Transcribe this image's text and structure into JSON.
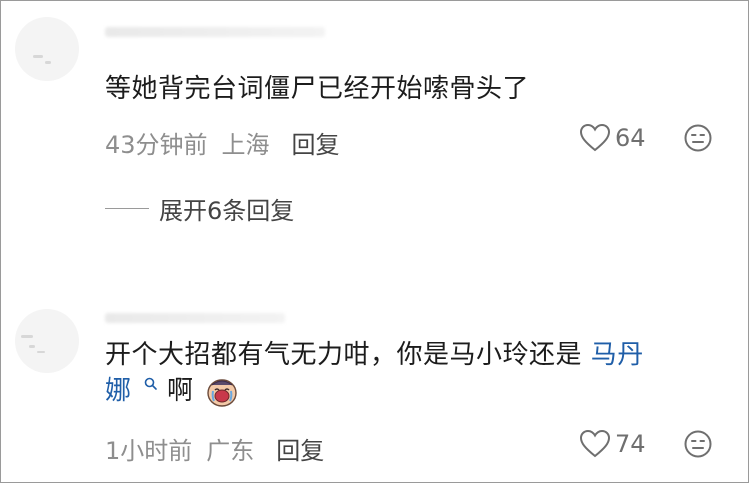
{
  "comments": [
    {
      "text": "等她背完台词僵尸已经开始嗦骨头了",
      "time": "43分钟前",
      "location": "上海",
      "reply_label": "回复",
      "likes": "64",
      "expand_label": "展开6条回复"
    },
    {
      "text_main": "开个大招都有气无力咁，你是马小玲还是",
      "link_text_1": "马丹",
      "link_text_2": "娜",
      "text_suffix": "啊",
      "time": "1小时前",
      "location": "广东",
      "reply_label": "回复",
      "likes": "74"
    }
  ],
  "colors": {
    "link": "#1f5ea8",
    "meta": "#8e8e8e",
    "text": "#1c1c1c"
  },
  "icons": [
    "heart-icon",
    "dislike-face-icon",
    "search-icon",
    "crying-emoji-icon"
  ]
}
